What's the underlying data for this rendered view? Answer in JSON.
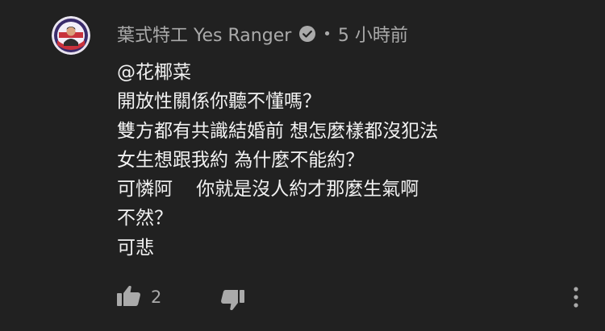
{
  "comment": {
    "author": "葉式特工 Yes Ranger",
    "verified_icon": "verified-check-icon",
    "separator": "•",
    "time": "5 小時前",
    "lines": [
      "@花椰菜",
      "開放性關係你聽不懂嗎？",
      "雙方都有共識結婚前 想怎麼樣都沒犯法",
      "女生想跟我約 為什麼不能約？",
      "可憐阿    你就是沒人約才那麼生氣啊",
      "不然？",
      "可悲"
    ]
  },
  "actions": {
    "like_icon": "thumbs-up-icon",
    "like_count": "2",
    "dislike_icon": "thumbs-down-icon",
    "more_icon": "more-vertical-icon"
  },
  "colors": {
    "background": "#212121",
    "text_primary": "#f1f1f1",
    "text_secondary": "#aaaaaa"
  }
}
